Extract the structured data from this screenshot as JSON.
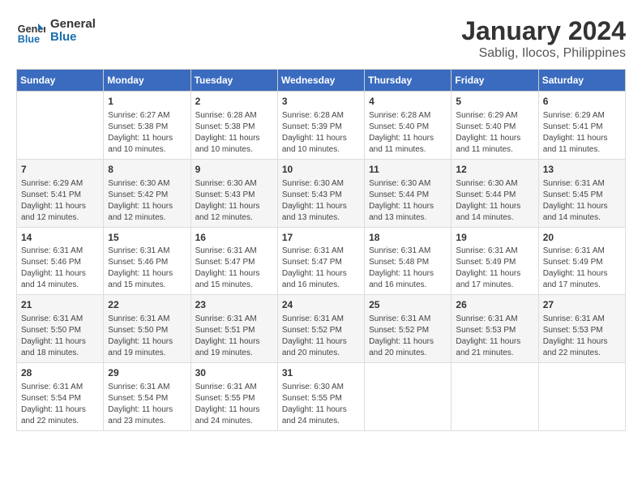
{
  "logo": {
    "line1": "General",
    "line2": "Blue"
  },
  "title": "January 2024",
  "subtitle": "Sablig, Ilocos, Philippines",
  "days_of_week": [
    "Sunday",
    "Monday",
    "Tuesday",
    "Wednesday",
    "Thursday",
    "Friday",
    "Saturday"
  ],
  "weeks": [
    [
      {
        "day": "",
        "info": ""
      },
      {
        "day": "1",
        "info": "Sunrise: 6:27 AM\nSunset: 5:38 PM\nDaylight: 11 hours\nand 10 minutes."
      },
      {
        "day": "2",
        "info": "Sunrise: 6:28 AM\nSunset: 5:38 PM\nDaylight: 11 hours\nand 10 minutes."
      },
      {
        "day": "3",
        "info": "Sunrise: 6:28 AM\nSunset: 5:39 PM\nDaylight: 11 hours\nand 10 minutes."
      },
      {
        "day": "4",
        "info": "Sunrise: 6:28 AM\nSunset: 5:40 PM\nDaylight: 11 hours\nand 11 minutes."
      },
      {
        "day": "5",
        "info": "Sunrise: 6:29 AM\nSunset: 5:40 PM\nDaylight: 11 hours\nand 11 minutes."
      },
      {
        "day": "6",
        "info": "Sunrise: 6:29 AM\nSunset: 5:41 PM\nDaylight: 11 hours\nand 11 minutes."
      }
    ],
    [
      {
        "day": "7",
        "info": "Sunrise: 6:29 AM\nSunset: 5:41 PM\nDaylight: 11 hours\nand 12 minutes."
      },
      {
        "day": "8",
        "info": "Sunrise: 6:30 AM\nSunset: 5:42 PM\nDaylight: 11 hours\nand 12 minutes."
      },
      {
        "day": "9",
        "info": "Sunrise: 6:30 AM\nSunset: 5:43 PM\nDaylight: 11 hours\nand 12 minutes."
      },
      {
        "day": "10",
        "info": "Sunrise: 6:30 AM\nSunset: 5:43 PM\nDaylight: 11 hours\nand 13 minutes."
      },
      {
        "day": "11",
        "info": "Sunrise: 6:30 AM\nSunset: 5:44 PM\nDaylight: 11 hours\nand 13 minutes."
      },
      {
        "day": "12",
        "info": "Sunrise: 6:30 AM\nSunset: 5:44 PM\nDaylight: 11 hours\nand 14 minutes."
      },
      {
        "day": "13",
        "info": "Sunrise: 6:31 AM\nSunset: 5:45 PM\nDaylight: 11 hours\nand 14 minutes."
      }
    ],
    [
      {
        "day": "14",
        "info": "Sunrise: 6:31 AM\nSunset: 5:46 PM\nDaylight: 11 hours\nand 14 minutes."
      },
      {
        "day": "15",
        "info": "Sunrise: 6:31 AM\nSunset: 5:46 PM\nDaylight: 11 hours\nand 15 minutes."
      },
      {
        "day": "16",
        "info": "Sunrise: 6:31 AM\nSunset: 5:47 PM\nDaylight: 11 hours\nand 15 minutes."
      },
      {
        "day": "17",
        "info": "Sunrise: 6:31 AM\nSunset: 5:47 PM\nDaylight: 11 hours\nand 16 minutes."
      },
      {
        "day": "18",
        "info": "Sunrise: 6:31 AM\nSunset: 5:48 PM\nDaylight: 11 hours\nand 16 minutes."
      },
      {
        "day": "19",
        "info": "Sunrise: 6:31 AM\nSunset: 5:49 PM\nDaylight: 11 hours\nand 17 minutes."
      },
      {
        "day": "20",
        "info": "Sunrise: 6:31 AM\nSunset: 5:49 PM\nDaylight: 11 hours\nand 17 minutes."
      }
    ],
    [
      {
        "day": "21",
        "info": "Sunrise: 6:31 AM\nSunset: 5:50 PM\nDaylight: 11 hours\nand 18 minutes."
      },
      {
        "day": "22",
        "info": "Sunrise: 6:31 AM\nSunset: 5:50 PM\nDaylight: 11 hours\nand 19 minutes."
      },
      {
        "day": "23",
        "info": "Sunrise: 6:31 AM\nSunset: 5:51 PM\nDaylight: 11 hours\nand 19 minutes."
      },
      {
        "day": "24",
        "info": "Sunrise: 6:31 AM\nSunset: 5:52 PM\nDaylight: 11 hours\nand 20 minutes."
      },
      {
        "day": "25",
        "info": "Sunrise: 6:31 AM\nSunset: 5:52 PM\nDaylight: 11 hours\nand 20 minutes."
      },
      {
        "day": "26",
        "info": "Sunrise: 6:31 AM\nSunset: 5:53 PM\nDaylight: 11 hours\nand 21 minutes."
      },
      {
        "day": "27",
        "info": "Sunrise: 6:31 AM\nSunset: 5:53 PM\nDaylight: 11 hours\nand 22 minutes."
      }
    ],
    [
      {
        "day": "28",
        "info": "Sunrise: 6:31 AM\nSunset: 5:54 PM\nDaylight: 11 hours\nand 22 minutes."
      },
      {
        "day": "29",
        "info": "Sunrise: 6:31 AM\nSunset: 5:54 PM\nDaylight: 11 hours\nand 23 minutes."
      },
      {
        "day": "30",
        "info": "Sunrise: 6:31 AM\nSunset: 5:55 PM\nDaylight: 11 hours\nand 24 minutes."
      },
      {
        "day": "31",
        "info": "Sunrise: 6:30 AM\nSunset: 5:55 PM\nDaylight: 11 hours\nand 24 minutes."
      },
      {
        "day": "",
        "info": ""
      },
      {
        "day": "",
        "info": ""
      },
      {
        "day": "",
        "info": ""
      }
    ]
  ]
}
